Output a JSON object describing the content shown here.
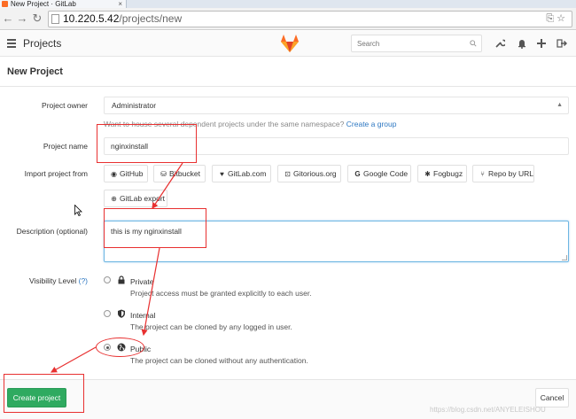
{
  "browser": {
    "tab_title": "New Project · GitLab",
    "tab_close": "×",
    "url_host": "10.220.5.42",
    "url_path": "/projects/new"
  },
  "header": {
    "title": "Projects",
    "search_placeholder": "Search",
    "brand_color": "#fc6d26"
  },
  "page": {
    "heading": "New Project"
  },
  "form": {
    "owner_label": "Project owner",
    "owner_value": "Administrator",
    "owner_help": "Want to house several dependent projects under the same namespace?",
    "owner_help_link": "Create a group",
    "name_label": "Project name",
    "name_value": "nginxinstall",
    "import_label": "Import project from",
    "import_sources": [
      "GitHub",
      "Bitbucket",
      "GitLab.com",
      "Gitorious.org",
      "Google Code",
      "Fogbugz",
      "Repo by URL",
      "GitLab export"
    ],
    "description_label": "Description (optional)",
    "description_value": "this is my nginxinstall",
    "visibility_label": "Visibility Level",
    "visibility_help": "(?)",
    "visibility_options": [
      {
        "title": "Private",
        "desc": "Project access must be granted explicitly to each user.",
        "selected": false
      },
      {
        "title": "Internal",
        "desc": "The project can be cloned by any logged in user.",
        "selected": false
      },
      {
        "title": "Public",
        "desc": "The project can be cloned without any authentication.",
        "selected": true
      }
    ]
  },
  "footer": {
    "create_label": "Create project",
    "cancel_label": "Cancel",
    "create_color": "#2faa60"
  },
  "watermark": "https://blog.csdn.net/ANYELEISHOU",
  "annotation_color": "#e83030"
}
